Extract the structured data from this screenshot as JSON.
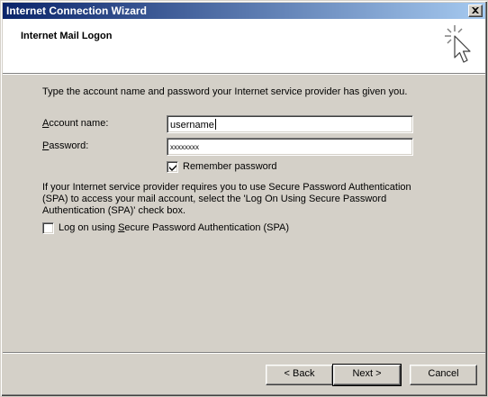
{
  "window": {
    "title": "Internet Connection Wizard"
  },
  "header": {
    "heading": "Internet Mail Logon"
  },
  "form": {
    "intro": "Type the account name and password your Internet service provider has given you.",
    "account_label_mnemonic": "A",
    "account_label_rest": "ccount name:",
    "account_value": "username",
    "password_label_mnemonic": "P",
    "password_label_rest": "assword:",
    "password_value": "xxxxxxxx",
    "remember_label": "Remember password",
    "remember_checked": true,
    "spa_info": "If your Internet service provider requires you to use Secure Password Authentication (SPA) to access your mail account, select the 'Log On Using Secure Password Authentication (SPA)' check box.",
    "spa_label_prefix": "Log on using ",
    "spa_label_mnemonic": "S",
    "spa_label_rest": "ecure Password Authentication (SPA)",
    "spa_checked": false
  },
  "buttons": {
    "back": "< Back",
    "next": "Next >",
    "cancel": "Cancel"
  },
  "icons": {
    "close": "close-icon",
    "wizard": "wizard-cursor-sparkle-icon",
    "checkmark": "checkmark-icon"
  }
}
